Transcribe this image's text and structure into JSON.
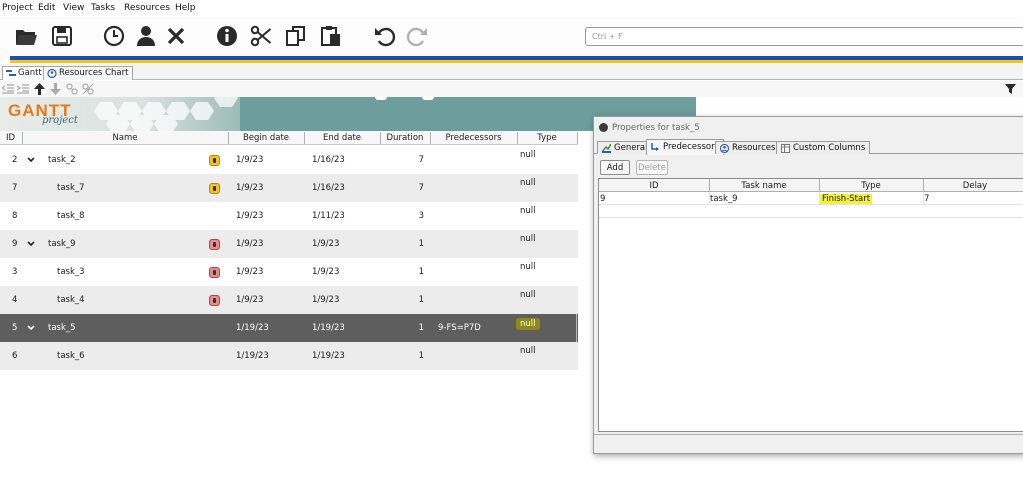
{
  "menu": [
    {
      "label": "Project"
    },
    {
      "label": "Edit"
    },
    {
      "label": "View"
    },
    {
      "label": "Tasks"
    },
    {
      "label": "Resources"
    },
    {
      "label": "Help"
    }
  ],
  "toolbar": {
    "icons": [
      "open-folder-icon",
      "save-icon",
      "clock-icon",
      "person-icon",
      "close-icon",
      "info-icon",
      "scissors-icon",
      "copy-icon",
      "paste-icon",
      "undo-icon",
      "redo-icon"
    ],
    "search_placeholder": "Ctrl + F"
  },
  "tabs": [
    {
      "label": "Gantt",
      "active": true
    },
    {
      "label": "Resources Chart",
      "active": false
    }
  ],
  "banner": {
    "gantt": "GANTT",
    "project": "project"
  },
  "grid": {
    "columns": [
      "ID",
      "Name",
      "Begin date",
      "End date",
      "Duration",
      "Predecessors",
      "Type"
    ],
    "rows": [
      {
        "id": "2",
        "name": "task_2",
        "expand": true,
        "indent": false,
        "resource": "yellow",
        "begin": "1/9/23",
        "end": "1/16/23",
        "duration": "7",
        "pred": "",
        "type": "null",
        "style": "normal"
      },
      {
        "id": "7",
        "name": "task_7",
        "expand": false,
        "indent": true,
        "resource": "yellow",
        "begin": "1/9/23",
        "end": "1/16/23",
        "duration": "7",
        "pred": "",
        "type": "null",
        "style": "alt"
      },
      {
        "id": "8",
        "name": "task_8",
        "expand": false,
        "indent": true,
        "resource": "",
        "begin": "1/9/23",
        "end": "1/11/23",
        "duration": "3",
        "pred": "",
        "type": "null",
        "style": "normal"
      },
      {
        "id": "9",
        "name": "task_9",
        "expand": true,
        "indent": false,
        "resource": "red",
        "begin": "1/9/23",
        "end": "1/9/23",
        "duration": "1",
        "pred": "",
        "type": "null",
        "style": "alt"
      },
      {
        "id": "3",
        "name": "task_3",
        "expand": false,
        "indent": true,
        "resource": "red",
        "begin": "1/9/23",
        "end": "1/9/23",
        "duration": "1",
        "pred": "",
        "type": "null",
        "style": "normal"
      },
      {
        "id": "4",
        "name": "task_4",
        "expand": false,
        "indent": true,
        "resource": "red",
        "begin": "1/9/23",
        "end": "1/9/23",
        "duration": "1",
        "pred": "",
        "type": "null",
        "style": "alt"
      },
      {
        "id": "5",
        "name": "task_5",
        "expand": true,
        "indent": false,
        "resource": "",
        "begin": "1/19/23",
        "end": "1/19/23",
        "duration": "1",
        "pred": "9-FS=P7D",
        "type": "null",
        "style": "sel"
      },
      {
        "id": "6",
        "name": "task_6",
        "expand": false,
        "indent": true,
        "resource": "",
        "begin": "1/19/23",
        "end": "1/19/23",
        "duration": "1",
        "pred": "",
        "type": "null",
        "style": "alt"
      }
    ]
  },
  "dialog": {
    "title": "Properties for task_5",
    "tabs": [
      {
        "label": "General"
      },
      {
        "label": "Predecessors"
      },
      {
        "label": "Resources"
      },
      {
        "label": "Custom Columns"
      }
    ],
    "add_label": "Add",
    "delete_label": "Delete",
    "columns": [
      "ID",
      "Task name",
      "Type",
      "Delay"
    ],
    "rows": [
      {
        "id": "9",
        "task_name": "task_9",
        "type": "Finish-Start",
        "delay": "7"
      }
    ]
  }
}
